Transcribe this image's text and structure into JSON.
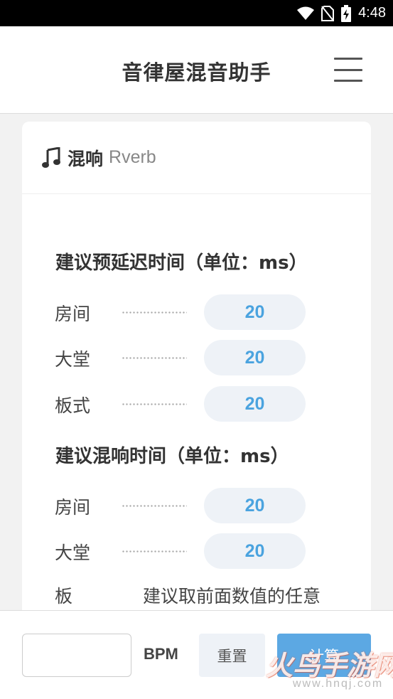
{
  "status_bar": {
    "time": "4:48",
    "icons": [
      "wifi-icon",
      "no-sim-icon",
      "battery-charging-icon"
    ]
  },
  "app_bar": {
    "title": "音律屋混音助手",
    "menu_icon": "hamburger-menu-icon"
  },
  "card": {
    "icon": "music-note-icon",
    "title": "混响",
    "subtitle": "Rverb",
    "sections": [
      {
        "title": "建议预延迟时间（单位：ms）",
        "rows": [
          {
            "label": "房间",
            "value": "20"
          },
          {
            "label": "大堂",
            "value": "20"
          },
          {
            "label": "板式",
            "value": "20"
          }
        ]
      },
      {
        "title": "建议混响时间（单位：ms）",
        "rows": [
          {
            "label": "房间",
            "value": "20"
          },
          {
            "label": "大堂",
            "value": "20"
          }
        ],
        "note_row": {
          "label": "板",
          "text": "建议取前面数值的任意"
        }
      }
    ]
  },
  "bottom_bar": {
    "bpm_value": "",
    "bpm_label": "BPM",
    "reset_label": "重置",
    "calc_label": "计算"
  },
  "watermark": {
    "text": "火鸟手游网",
    "url": "www.hnqj.com"
  },
  "colors": {
    "accent": "#4aa3df",
    "button_primary": "#5ca8e3",
    "pill_bg": "#eef2f7"
  }
}
